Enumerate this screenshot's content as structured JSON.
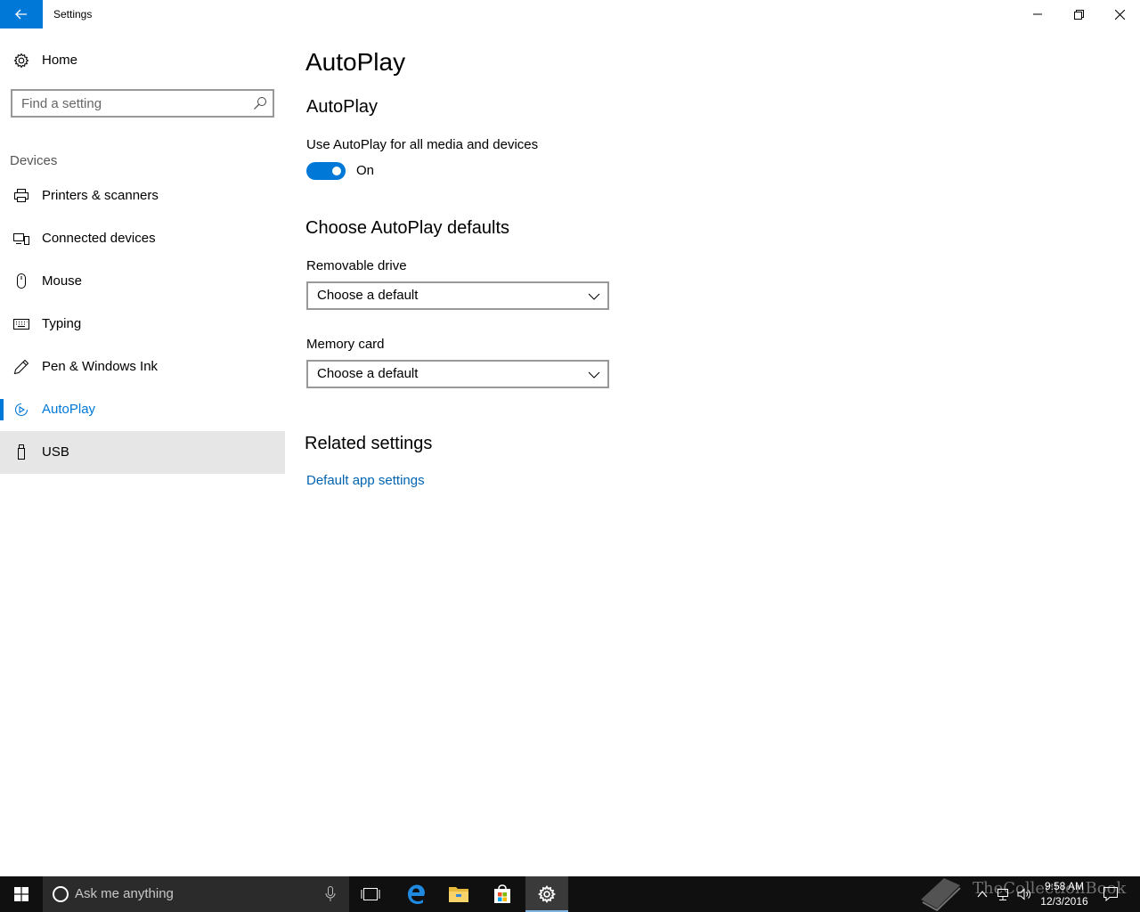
{
  "window": {
    "title": "Settings"
  },
  "sidebar": {
    "home_label": "Home",
    "search_placeholder": "Find a setting",
    "section_label": "Devices",
    "items": [
      {
        "label": "Printers & scanners",
        "icon": "printer-icon"
      },
      {
        "label": "Connected devices",
        "icon": "connected-devices-icon"
      },
      {
        "label": "Mouse",
        "icon": "mouse-icon"
      },
      {
        "label": "Typing",
        "icon": "keyboard-icon"
      },
      {
        "label": "Pen & Windows Ink",
        "icon": "pen-icon"
      },
      {
        "label": "AutoPlay",
        "icon": "autoplay-icon",
        "selected": true
      },
      {
        "label": "USB",
        "icon": "usb-icon",
        "hover": true
      }
    ]
  },
  "main": {
    "page_title": "AutoPlay",
    "autoplay_section": {
      "heading": "AutoPlay",
      "toggle_label": "Use AutoPlay for all media and devices",
      "toggle_state": "On",
      "toggle_on": true
    },
    "defaults_section": {
      "heading": "Choose AutoPlay defaults",
      "removable_drive_label": "Removable drive",
      "removable_drive_value": "Choose a default",
      "memory_card_label": "Memory card",
      "memory_card_value": "Choose a default"
    },
    "related_section": {
      "heading": "Related settings",
      "link": "Default app settings"
    }
  },
  "taskbar": {
    "search_placeholder": "Ask me anything",
    "time": "9:58 AM",
    "date": "12/3/2016",
    "watermark": "TheCollectionBook"
  },
  "colors": {
    "accent": "#0078d7",
    "link": "#0063b1",
    "taskbar": "#101010"
  }
}
